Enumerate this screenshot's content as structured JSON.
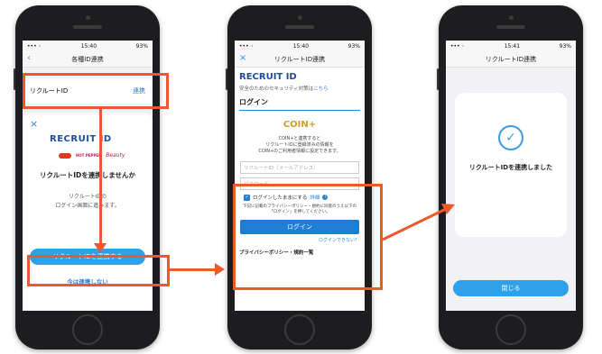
{
  "phone1": {
    "status": {
      "left": "••• ◦",
      "time": "15:40",
      "battery": "93%"
    },
    "nav_title": "各種ID連携",
    "row_label": "リクルートID",
    "row_action": "連携",
    "logo_text": "RECRUIT ID",
    "partner_logos": [
      "HOT PEPPER",
      "Beauty"
    ],
    "heading": "リクルートIDを連携しませんか",
    "desc_line1": "リクルートIDの",
    "desc_line2": "ログイン画面に進みます。",
    "primary_button": "リクルートIDを連携する",
    "secondary_link": "今は連携しない"
  },
  "phone2": {
    "status": {
      "left": "••• ◦",
      "time": "15:40",
      "battery": "93%"
    },
    "nav_title": "リクルートID連携",
    "logo_text": "RECRUIT ID",
    "security_text": "安全のためのセキュリティ対策は",
    "security_link": "こちら",
    "login_heading": "ログイン",
    "coin_logo": "COIN+",
    "coin_desc_1": "COIN+と連携すると",
    "coin_desc_2": "リクルートIDに登録済みの情報を",
    "coin_desc_3": "COIN+のご利用者情報に設定できます。",
    "id_placeholder": "リクルートID（メールアドレス）",
    "password_placeholder": "パスワード",
    "keep_login": "ログインしたままにする",
    "keep_login_detail": "詳細",
    "agree_line1": "下記に記載のプライバシーポリシー・規約に同意のうえ以下の",
    "agree_line2": "「ログイン」を押してください。",
    "login_button": "ログイン",
    "cant_login": "ログインできない？",
    "policy_link": "プライバシーポリシー・規約一覧"
  },
  "phone3": {
    "status": {
      "left": "••• ◦",
      "time": "15:41",
      "battery": "93%"
    },
    "nav_title": "リクルートID連携",
    "message": "リクルートIDを連携しました",
    "close_button": "閉じる"
  },
  "colors": {
    "accent": "#2ea1ea",
    "highlight": "#ec5a2c",
    "brand": "#1f4e96"
  }
}
